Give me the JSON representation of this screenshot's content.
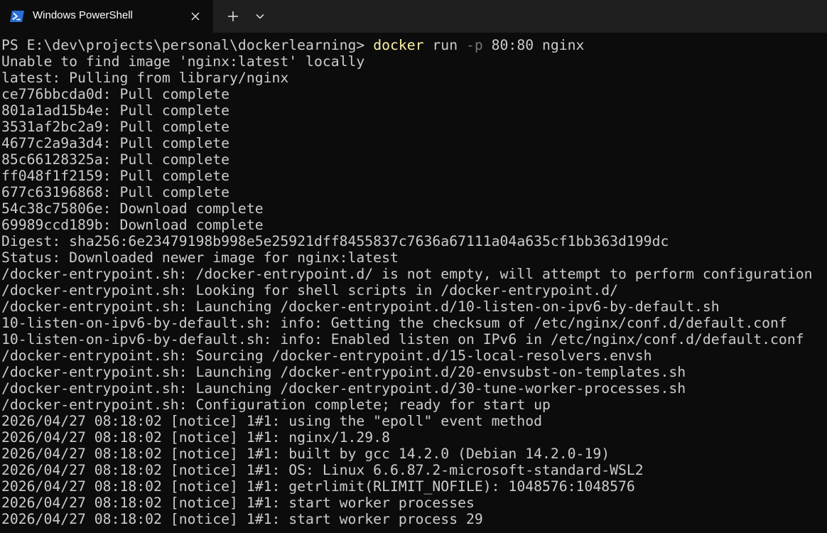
{
  "tab": {
    "title": "Windows PowerShell",
    "icon": "powershell-icon",
    "close_icon": "close-icon",
    "new_tab_icon": "plus-icon",
    "dropdown_icon": "chevron-down-icon"
  },
  "colors": {
    "background": "#0c0c0c",
    "titlebar": "#1f1f1f",
    "text": "#cccccc",
    "command": "#f9f1a5",
    "flag": "#767676",
    "powershell_icon": "#2a6fd6"
  },
  "terminal": {
    "prompt": "PS E:\\dev\\projects\\personal\\dockerlearning> ",
    "command": {
      "name": "docker",
      "sub": " run ",
      "flag": "-p",
      "rest": " 80:80 nginx"
    },
    "output": [
      "Unable to find image 'nginx:latest' locally",
      "latest: Pulling from library/nginx",
      "ce776bbcda0d: Pull complete",
      "801a1ad15b4e: Pull complete",
      "3531af2bc2a9: Pull complete",
      "4677c2a9a3d4: Pull complete",
      "85c66128325a: Pull complete",
      "ff048f1f2159: Pull complete",
      "677c63196868: Pull complete",
      "54c38c75806e: Download complete",
      "69989ccd189b: Download complete",
      "Digest: sha256:6e23479198b998e5e25921dff8455837c7636a67111a04a635cf1bb363d199dc",
      "Status: Downloaded newer image for nginx:latest",
      "/docker-entrypoint.sh: /docker-entrypoint.d/ is not empty, will attempt to perform configuration",
      "/docker-entrypoint.sh: Looking for shell scripts in /docker-entrypoint.d/",
      "/docker-entrypoint.sh: Launching /docker-entrypoint.d/10-listen-on-ipv6-by-default.sh",
      "10-listen-on-ipv6-by-default.sh: info: Getting the checksum of /etc/nginx/conf.d/default.conf",
      "10-listen-on-ipv6-by-default.sh: info: Enabled listen on IPv6 in /etc/nginx/conf.d/default.conf",
      "/docker-entrypoint.sh: Sourcing /docker-entrypoint.d/15-local-resolvers.envsh",
      "/docker-entrypoint.sh: Launching /docker-entrypoint.d/20-envsubst-on-templates.sh",
      "/docker-entrypoint.sh: Launching /docker-entrypoint.d/30-tune-worker-processes.sh",
      "/docker-entrypoint.sh: Configuration complete; ready for start up",
      "2026/04/27 08:18:02 [notice] 1#1: using the \"epoll\" event method",
      "2026/04/27 08:18:02 [notice] 1#1: nginx/1.29.8",
      "2026/04/27 08:18:02 [notice] 1#1: built by gcc 14.2.0 (Debian 14.2.0-19)",
      "2026/04/27 08:18:02 [notice] 1#1: OS: Linux 6.6.87.2-microsoft-standard-WSL2",
      "2026/04/27 08:18:02 [notice] 1#1: getrlimit(RLIMIT_NOFILE): 1048576:1048576",
      "2026/04/27 08:18:02 [notice] 1#1: start worker processes",
      "2026/04/27 08:18:02 [notice] 1#1: start worker process 29"
    ]
  }
}
